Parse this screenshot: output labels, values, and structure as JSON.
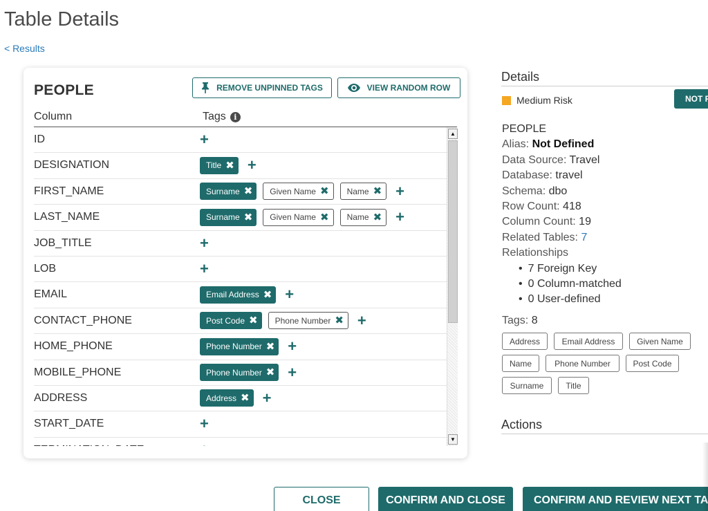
{
  "page": {
    "title": "Table Details",
    "back_link": "< Results"
  },
  "card": {
    "title": "PEOPLE",
    "remove_button": "REMOVE UNPINNED TAGS",
    "view_button": "VIEW RANDOM ROW",
    "column_header": "Column",
    "tags_header": "Tags",
    "rows": [
      {
        "name": "ID",
        "tags": []
      },
      {
        "name": "DESIGNATION",
        "tags": [
          {
            "label": "Title",
            "pinned": true
          }
        ]
      },
      {
        "name": "FIRST_NAME",
        "tags": [
          {
            "label": "Surname",
            "pinned": true
          },
          {
            "label": "Given Name",
            "pinned": false
          },
          {
            "label": "Name",
            "pinned": false
          }
        ]
      },
      {
        "name": "LAST_NAME",
        "tags": [
          {
            "label": "Surname",
            "pinned": true
          },
          {
            "label": "Given Name",
            "pinned": false
          },
          {
            "label": "Name",
            "pinned": false
          }
        ]
      },
      {
        "name": "JOB_TITLE",
        "tags": []
      },
      {
        "name": "LOB",
        "tags": []
      },
      {
        "name": "EMAIL",
        "tags": [
          {
            "label": "Email Address",
            "pinned": true
          }
        ]
      },
      {
        "name": "CONTACT_PHONE",
        "tags": [
          {
            "label": "Post Code",
            "pinned": true
          },
          {
            "label": "Phone Number",
            "pinned": false
          }
        ]
      },
      {
        "name": "HOME_PHONE",
        "tags": [
          {
            "label": "Phone Number",
            "pinned": true
          }
        ]
      },
      {
        "name": "MOBILE_PHONE",
        "tags": [
          {
            "label": "Phone Number",
            "pinned": true
          }
        ]
      },
      {
        "name": "ADDRESS",
        "tags": [
          {
            "label": "Address",
            "pinned": true
          }
        ]
      },
      {
        "name": "START_DATE",
        "tags": []
      },
      {
        "name": "TERMINATION_DATE",
        "tags": []
      }
    ]
  },
  "details": {
    "title": "Details",
    "risk": "Medium Risk",
    "risk_color": "#f5a623",
    "status_button": "NOT R",
    "table_name": "PEOPLE",
    "alias_label": "Alias:",
    "alias_value": "Not Defined",
    "data_source_label": "Data Source:",
    "data_source_value": "Travel",
    "database_label": "Database:",
    "database_value": "travel",
    "schema_label": "Schema:",
    "schema_value": "dbo",
    "row_count_label": "Row Count:",
    "row_count_value": "418",
    "column_count_label": "Column Count:",
    "column_count_value": "19",
    "related_label": "Related Tables:",
    "related_value": "7",
    "relationships_label": "Relationships",
    "relationships": [
      "7 Foreign Key",
      "0 Column-matched",
      "0 User-defined"
    ],
    "tags_label": "Tags:",
    "tags_value": "8",
    "tags": [
      "Address",
      "Email Address",
      "Given Name",
      "Name",
      "Phone Number",
      "Post Code",
      "Surname",
      "Title"
    ],
    "actions_title": "Actions"
  },
  "footer": {
    "close": "CLOSE",
    "confirm_close": "CONFIRM AND CLOSE",
    "confirm_next": "CONFIRM AND REVIEW NEXT TABL"
  },
  "colors": {
    "accent": "#1f6b6b",
    "link": "#2a7ab8"
  }
}
